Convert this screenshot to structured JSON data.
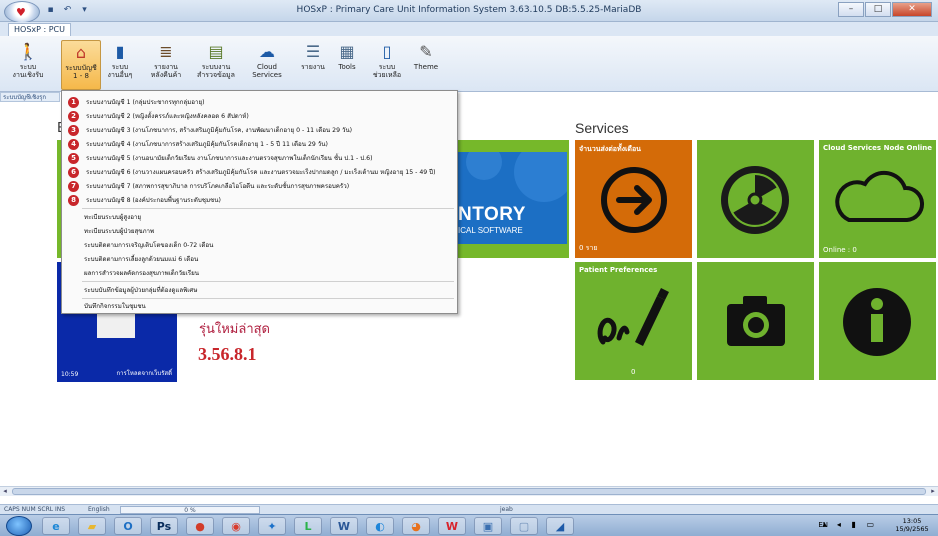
{
  "window": {
    "title": "HOSxP : Primary Care Unit Information System 3.63.10.5 DB:5.5.25-MariaDB",
    "tab": "HOSxP : PCU",
    "controls": [
      "–",
      "□",
      "✕"
    ]
  },
  "ribbon": {
    "buttons": [
      {
        "label": "ระบบ\nงานเชิงรับ",
        "icon": "walking-person-icon"
      },
      {
        "label": "ระบบบัญชี\n1 - 8",
        "icon": "home-icon",
        "active": true
      },
      {
        "label": "ระบบ\nงานอื่นๆ",
        "icon": "book-icon"
      },
      {
        "label": "รายงาน\nหลังคืนค้า",
        "icon": "books-stack-icon"
      },
      {
        "label": "ระบบงาน\nสำรวจข้อมูล",
        "icon": "clipboard-icon"
      },
      {
        "label": "Cloud\nServices",
        "icon": "cloud-window-icon"
      },
      {
        "label": "รายงาน",
        "icon": "report-icon"
      },
      {
        "label": "Tools",
        "icon": "tools-icon"
      },
      {
        "label": "ระบบ\nช่วยเหลือ",
        "icon": "help-book-icon"
      },
      {
        "label": "Theme",
        "icon": "paint-icon"
      }
    ],
    "group_label": "ระบบบัญชีเชิงรุก"
  },
  "dropdown": {
    "numbered_items": [
      {
        "num": "1",
        "label": "ระบบงานบัญชี 1 (กลุ่มประชากรทุกกลุ่มอายุ)"
      },
      {
        "num": "2",
        "label": "ระบบงานบัญชี 2 (หญิงตั้งครรภ์และหญิงหลังคลอด 6 สัปดาห์)"
      },
      {
        "num": "3",
        "label": "ระบบงานบัญชี 3 (งานโภชนาการ, สร้างเสริมภูมิคุ้มกันโรค, งานพัฒนาเด็กอายุ 0 - 11 เดือน 29 วัน)"
      },
      {
        "num": "4",
        "label": "ระบบงานบัญชี 4 (งานโภชนาการสร้างเสริมภูมิคุ้มกันโรคเด็กอายุ 1 - 5 ปี 11 เดือน 29 วัน)"
      },
      {
        "num": "5",
        "label": "ระบบงานบัญชี 5 (งานอนามัยเด็กวัยเรียน งานโภชนาการและงานตรวจสุขภาพในเด็กนักเรียน ชั้น ป.1 - ป.6)"
      },
      {
        "num": "6",
        "label": "ระบบงานบัญชี 6 (งานวางแผนครอบครัว สร้างเสริมภูมิคุ้มกันโรค และงานตรวจมะเร็งปากมดลูก / มะเร็งเต้านม หญิงอายุ 15 - 49 ปี)"
      },
      {
        "num": "7",
        "label": "ระบบงานบัญชี 7 (สภาพการสุขาภิบาล การบริโภคเกลือไอโอดีน และระดับชั้นการสุขภาพครอบครัว)"
      },
      {
        "num": "8",
        "label": "ระบบงานบัญชี 8 (องค์ประกอบพื้นฐานระดับชุมชน)"
      }
    ],
    "plain_items": [
      "ทะเบียนระบบผู้สูงอายุ",
      "ทะเบียนระบบผู้ป่วยสุขภาพ",
      "ระบบติดตามการเจริญเติบโตของเด็ก 0-72 เดือน",
      "ระบบติดตามการเลี้ยงลูกด้วยนมแม่ 6 เดือน",
      "ผลการสำรวจผลคัดกรองสุขภาพเด็กวัยเรียน"
    ],
    "extra_items": [
      "ระบบบันทึกข้อมูลผู้ป่วยกลุ่มที่ต้องดูแลพิเศษ",
      "บันทึกกิจกรรมในชุมชน"
    ]
  },
  "content": {
    "b_heading": "B",
    "services_heading": "Services",
    "inventory_text": "NTORY",
    "inventory_sub": "ICAL SOFTWARE",
    "latest_label": "รุ่นใหม่ล่าสุด",
    "version": "3.56.8.1",
    "blue_tile_time": "10:59",
    "blue_tile_caption": "การโหลดจากเว็บรัสดิ์",
    "tiles": {
      "refer": {
        "title": "จำนวนส่งต่อทั้งเดือน",
        "count": "0 ราย",
        "icon": "arrow-circle-icon",
        "color": "#d46b08"
      },
      "radiation": {
        "icon": "radiation-icon",
        "color": "#6fb22e"
      },
      "cloud": {
        "title": "Cloud Services",
        "status": "Node Online",
        "online": "Online : 0",
        "icon": "cloud-icon"
      },
      "patient": {
        "title": "Patient Preferences",
        "count": "0",
        "icon": "signature-pen-icon"
      },
      "camera": {
        "icon": "camera-icon"
      },
      "info": {
        "icon": "info-icon"
      }
    }
  },
  "statusbar": {
    "keys": "CAPS  NUM  SCRL  INS",
    "language": "English",
    "progress": "0 %",
    "progress_value": 0,
    "user": "jeab"
  },
  "taskbar": {
    "pinned": [
      {
        "icon": "ie-icon",
        "glyph": "e",
        "color": "#1c87d6"
      },
      {
        "icon": "folder-icon",
        "glyph": "▰",
        "color": "#e8b730"
      },
      {
        "icon": "outlook-icon",
        "glyph": "O",
        "color": "#1d6fc4"
      },
      {
        "icon": "photoshop-icon",
        "glyph": "Ps",
        "color": "#0a2d5c"
      },
      {
        "icon": "app-icon",
        "glyph": "●",
        "color": "#d23c2a"
      },
      {
        "icon": "chrome-icon",
        "glyph": "◉",
        "color": "#d93a2c"
      },
      {
        "icon": "network-icon",
        "glyph": "✦",
        "color": "#1a70c9"
      },
      {
        "icon": "line-icon",
        "glyph": "L",
        "color": "#2bb34a"
      },
      {
        "icon": "word-icon",
        "glyph": "W",
        "color": "#2b5797"
      },
      {
        "icon": "chromium-icon",
        "glyph": "◐",
        "color": "#1f86d9"
      },
      {
        "icon": "firefox-icon",
        "glyph": "◕",
        "color": "#e8711e"
      },
      {
        "icon": "wps-icon",
        "glyph": "W",
        "color": "#d8242d"
      },
      {
        "icon": "monitor-icon",
        "glyph": "▣",
        "color": "#3a6fb0"
      },
      {
        "icon": "window-icon",
        "glyph": "▢",
        "color": "#6f8fb8"
      },
      {
        "icon": "hosxp-icon",
        "glyph": "◢",
        "color": "#1e5aa8"
      }
    ],
    "lang": "EN",
    "time": "13:05",
    "date": "15/9/2565"
  }
}
